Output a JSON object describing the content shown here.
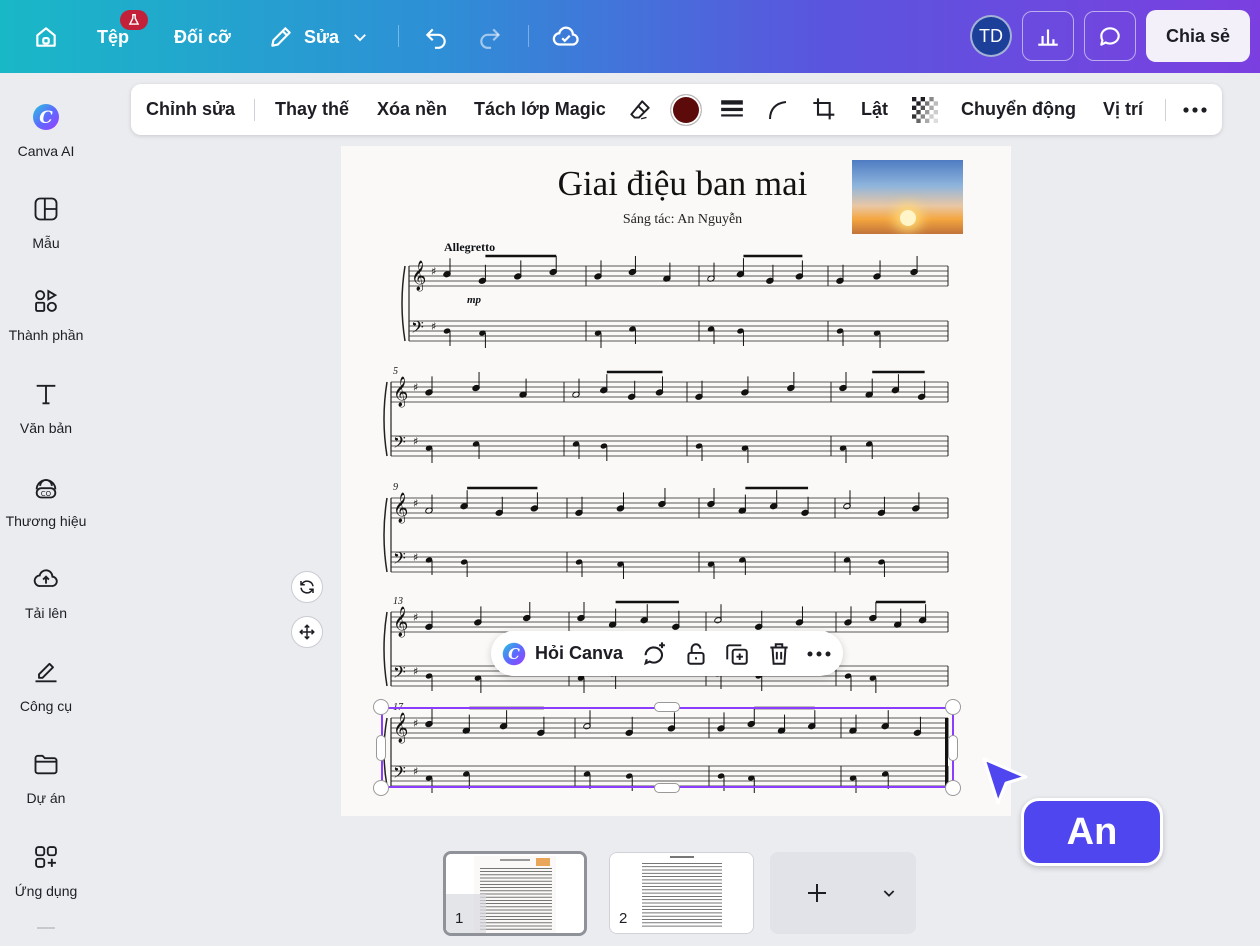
{
  "topbar": {
    "file_label": "Tệp",
    "resize_label": "Đối cỡ",
    "edit_label": "Sửa",
    "avatar_initials": "TD",
    "share_label": "Chia sẻ"
  },
  "sidebar": {
    "items": [
      {
        "label": "Canva AI",
        "icon": "canva-ai-icon"
      },
      {
        "label": "Mẫu",
        "icon": "templates-icon"
      },
      {
        "label": "Thành phần",
        "icon": "elements-icon"
      },
      {
        "label": "Văn bản",
        "icon": "text-icon"
      },
      {
        "label": "Thương hiệu",
        "icon": "brand-icon"
      },
      {
        "label": "Tải lên",
        "icon": "upload-icon"
      },
      {
        "label": "Công cụ",
        "icon": "tools-icon"
      },
      {
        "label": "Dự án",
        "icon": "projects-icon"
      },
      {
        "label": "Ứng dụng",
        "icon": "apps-icon"
      }
    ]
  },
  "context_toolbar": {
    "edit": "Chỉnh sửa",
    "replace": "Thay thế",
    "remove_bg": "Xóa nền",
    "magic_layer": "Tách lớp Magic",
    "flip": "Lật",
    "animate": "Chuyển động",
    "position": "Vị trí",
    "color": "#5c0a0a"
  },
  "score": {
    "title": "Giai điệu ban mai",
    "composer": "Sáng tác: An Nguyễn",
    "tempo": "Allegretto",
    "dynamic": "mp",
    "measure_numbers": [
      "5",
      "9",
      "13",
      "17"
    ]
  },
  "float_toolbar": {
    "ask_canva": "Hỏi Canva"
  },
  "collaborator": {
    "name": "An",
    "color": "#4f46f0"
  },
  "pages": {
    "thumbs": [
      "1",
      "2"
    ]
  },
  "accent_color": "#8b3dff"
}
